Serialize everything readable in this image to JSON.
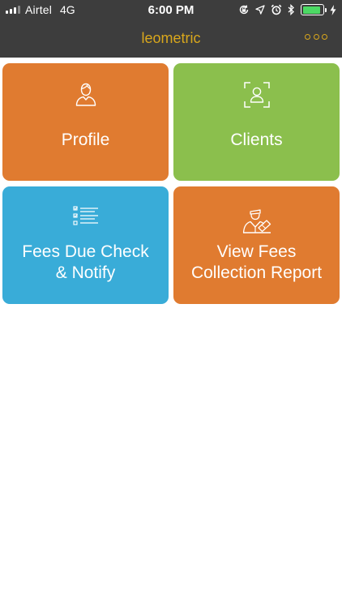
{
  "status_bar": {
    "carrier": "Airtel",
    "network": "4G",
    "time": "6:00 PM",
    "signal_bars": 3,
    "signal_bars_total": 4,
    "battery_level": 0.9,
    "battery_color": "#4cd964",
    "icons": [
      "orientation-lock-icon",
      "location-arrow-icon",
      "alarm-icon",
      "bluetooth-icon",
      "battery-icon",
      "charging-bolt-icon"
    ]
  },
  "navbar": {
    "title": "leometric",
    "accent_color": "#d9a71c",
    "menu_icon": "more-options-icon"
  },
  "tiles": [
    {
      "label": "Profile",
      "icon": "person-icon",
      "color": "#e07b30"
    },
    {
      "label": "Clients",
      "icon": "client-frame-icon",
      "color": "#8bbf4d"
    },
    {
      "label_line1": "Fees Due Check",
      "label_line2": "& Notify",
      "icon": "checklist-icon",
      "color": "#39acd8"
    },
    {
      "label_line1": "View Fees",
      "label_line2": "Collection Report",
      "icon": "collector-icon",
      "color": "#e07b30"
    }
  ]
}
